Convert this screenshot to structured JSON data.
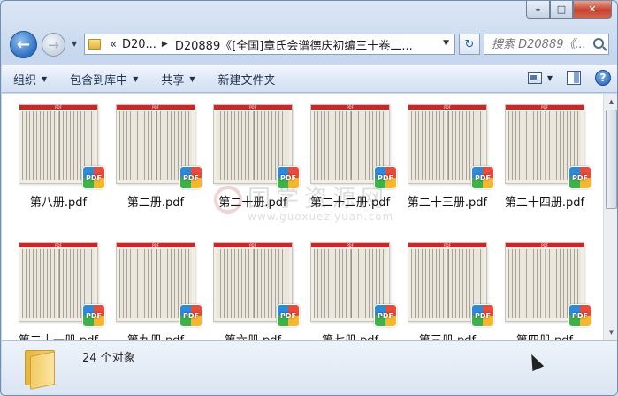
{
  "caption": {
    "minimize": "–",
    "maximize": "□",
    "close": "✕"
  },
  "nav": {
    "back_glyph": "←",
    "forward_glyph": "→",
    "history_glyph": "▼",
    "breadcrumb": [
      {
        "label": "«"
      },
      {
        "label": "D20..."
      },
      {
        "label": "D20889《[全国]章氏会谱德庆初编三十卷二..."
      }
    ],
    "dropdown_glyph": "▼",
    "refresh_glyph": "↻",
    "search_placeholder": "搜索 D20889《..."
  },
  "toolbar": {
    "organize": "组织",
    "include_in_library": "包含到库中",
    "share": "共享",
    "new_folder": "新建文件夹",
    "help": "?"
  },
  "files": [
    {
      "name": "第八册.pdf"
    },
    {
      "name": "第二册.pdf"
    },
    {
      "name": "第二十册.pdf"
    },
    {
      "name": "第二十二册.pdf"
    },
    {
      "name": "第二十三册.pdf"
    },
    {
      "name": "第二十四册.pdf"
    },
    {
      "name": "第二十一册.pdf"
    },
    {
      "name": "第九册.pdf"
    },
    {
      "name": "第六册.pdf"
    },
    {
      "name": "第七册.pdf"
    },
    {
      "name": "第三册.pdf"
    },
    {
      "name": "第四册.pdf"
    }
  ],
  "thumb_header": "PDF",
  "pdf_badge": "PDF",
  "watermark": {
    "title": "国学资源网",
    "url": "www.guoxueziyuan.com"
  },
  "status": {
    "count": "24 个对象"
  },
  "scroll": {
    "up": "▲",
    "down": "▼"
  },
  "colors": {
    "accent": "#2d6fc0",
    "close": "#c7432b",
    "pdf_header": "#c9282b"
  }
}
